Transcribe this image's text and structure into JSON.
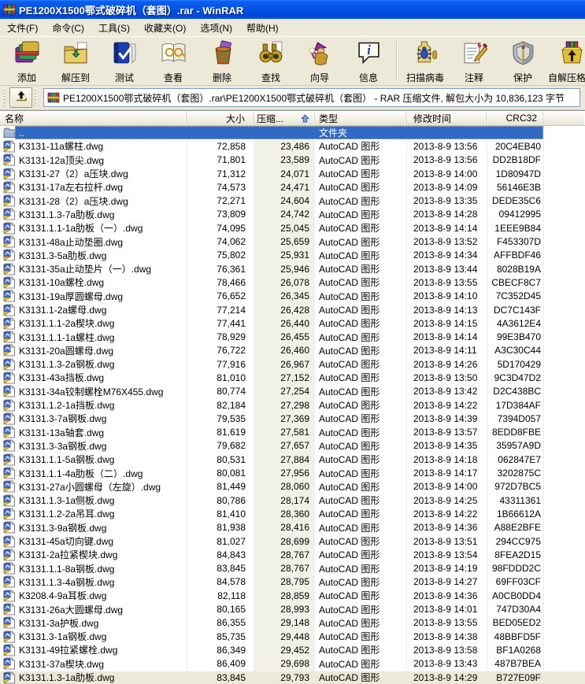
{
  "window": {
    "title": "PE1200X1500鄂式破碎机（套图）.rar - WinRAR"
  },
  "menu": {
    "items": [
      {
        "label": "文件(F)"
      },
      {
        "label": "命令(C)"
      },
      {
        "label": "工具(S)"
      },
      {
        "label": "收藏夹(O)"
      },
      {
        "label": "选项(N)"
      },
      {
        "label": "帮助(H)"
      }
    ]
  },
  "toolbar": {
    "buttons": [
      {
        "icon": "add-archive-icon",
        "label": "添加"
      },
      {
        "icon": "extract-to-icon",
        "label": "解压到"
      },
      {
        "icon": "test-archive-icon",
        "label": "测试"
      },
      {
        "icon": "view-file-icon",
        "label": "查看"
      },
      {
        "icon": "delete-icon",
        "label": "删除"
      },
      {
        "icon": "find-icon",
        "label": "查找"
      },
      {
        "icon": "wizard-icon",
        "label": "向导"
      },
      {
        "icon": "info-icon",
        "label": "信息"
      },
      {
        "icon": "virus-scan-icon",
        "label": "扫描病毒"
      },
      {
        "icon": "comment-icon",
        "label": "注释"
      },
      {
        "icon": "protect-icon",
        "label": "保护"
      },
      {
        "icon": "sfx-icon",
        "label": "自解压格式"
      }
    ]
  },
  "addressbar": {
    "path": "PE1200X1500鄂式破碎机（套图）.rar\\PE1200X1500鄂式破碎机（套图） - RAR 压缩文件, 解包大小为 10,836,123 字节"
  },
  "columns": {
    "name": "名称",
    "size": "大小",
    "packed": "压缩...",
    "type": "类型",
    "modified": "修改时间",
    "crc": "CRC32"
  },
  "folder_row": {
    "name": "..",
    "type": "文件夹"
  },
  "rows": [
    {
      "name": "K3131-11a螺柱.dwg",
      "size": "72,858",
      "packed": "23,486",
      "type": "AutoCAD 图形",
      "modified": "2013-8-9 13:56",
      "crc": "20C4EB40"
    },
    {
      "name": "K3131-12a顶尖.dwg",
      "size": "71,801",
      "packed": "23,589",
      "type": "AutoCAD 图形",
      "modified": "2013-8-9 13:56",
      "crc": "DD2B18DF"
    },
    {
      "name": "K3131-27（2）a压块.dwg",
      "size": "71,312",
      "packed": "24,071",
      "type": "AutoCAD 图形",
      "modified": "2013-8-9 14:00",
      "crc": "1D80947D"
    },
    {
      "name": "K3131-17a左右拉杆.dwg",
      "size": "74,573",
      "packed": "24,471",
      "type": "AutoCAD 图形",
      "modified": "2013-8-9 14:09",
      "crc": "56146E3B"
    },
    {
      "name": "K3131-28（2）a压块.dwg",
      "size": "72,271",
      "packed": "24,604",
      "type": "AutoCAD 图形",
      "modified": "2013-8-9 13:35",
      "crc": "DEDE35C6"
    },
    {
      "name": "K3131.1.3-7a肋板.dwg",
      "size": "73,809",
      "packed": "24,742",
      "type": "AutoCAD 图形",
      "modified": "2013-8-9 14:28",
      "crc": "09412995"
    },
    {
      "name": "K3131.1.1-1a肋板（一）.dwg",
      "size": "74,095",
      "packed": "25,045",
      "type": "AutoCAD 图形",
      "modified": "2013-8-9 14:14",
      "crc": "1EEE9B84"
    },
    {
      "name": "K3131-48a止动垫圈.dwg",
      "size": "74,062",
      "packed": "25,659",
      "type": "AutoCAD 图形",
      "modified": "2013-8-9 13:52",
      "crc": "F453307D"
    },
    {
      "name": "K3131.3-5a肋板.dwg",
      "size": "75,802",
      "packed": "25,931",
      "type": "AutoCAD 图形",
      "modified": "2013-8-9 14:34",
      "crc": "AFFBDF46"
    },
    {
      "name": "K3131-35a止动垫片（一）.dwg",
      "size": "76,361",
      "packed": "25,946",
      "type": "AutoCAD 图形",
      "modified": "2013-8-9 13:44",
      "crc": "8028B19A"
    },
    {
      "name": "K3131-10a螺栓.dwg",
      "size": "78,466",
      "packed": "26,078",
      "type": "AutoCAD 图形",
      "modified": "2013-8-9 13:55",
      "crc": "CBECF8C7"
    },
    {
      "name": "K3131-19a厚圆螺母.dwg",
      "size": "76,652",
      "packed": "26,345",
      "type": "AutoCAD 图形",
      "modified": "2013-8-9 14:10",
      "crc": "7C352D45"
    },
    {
      "name": "K3131.1-2a螺母.dwg",
      "size": "77,214",
      "packed": "26,428",
      "type": "AutoCAD 图形",
      "modified": "2013-8-9 14:13",
      "crc": "DC7C143F"
    },
    {
      "name": "K3131.1.1-2a楔块.dwg",
      "size": "77,441",
      "packed": "26,440",
      "type": "AutoCAD 图形",
      "modified": "2013-8-9 14:15",
      "crc": "4A3612E4"
    },
    {
      "name": "K3131.1.1-1a螺柱.dwg",
      "size": "78,929",
      "packed": "26,455",
      "type": "AutoCAD 图形",
      "modified": "2013-8-9 14:14",
      "crc": "99E3B470"
    },
    {
      "name": "K3131-20a圆螺母.dwg",
      "size": "76,722",
      "packed": "26,460",
      "type": "AutoCAD 图形",
      "modified": "2013-8-9 14:11",
      "crc": "A3C30C44"
    },
    {
      "name": "K3131.1.3-2a钢板.dwg",
      "size": "77,916",
      "packed": "26,967",
      "type": "AutoCAD 图形",
      "modified": "2013-8-9 14:26",
      "crc": "5D170429"
    },
    {
      "name": "K3131-43a挡板.dwg",
      "size": "81,010",
      "packed": "27,152",
      "type": "AutoCAD 图形",
      "modified": "2013-8-9 13:50",
      "crc": "9C3D47D2"
    },
    {
      "name": "K3131-34a铰制螺栓M76X455.dwg",
      "size": "80,774",
      "packed": "27,254",
      "type": "AutoCAD 图形",
      "modified": "2013-8-9 13:42",
      "crc": "D2C438BC"
    },
    {
      "name": "K3131.1.2-1a挡板.dwg",
      "size": "82,184",
      "packed": "27,298",
      "type": "AutoCAD 图形",
      "modified": "2013-8-9 14:22",
      "crc": "17D384AF"
    },
    {
      "name": "K3131.3-7a钢板.dwg",
      "size": "79,535",
      "packed": "27,369",
      "type": "AutoCAD 图形",
      "modified": "2013-8-9 14:39",
      "crc": "7394D057"
    },
    {
      "name": "K3131-13a轴套.dwg",
      "size": "81,619",
      "packed": "27,581",
      "type": "AutoCAD 图形",
      "modified": "2013-8-9 13:57",
      "crc": "8EDD8FBE"
    },
    {
      "name": "K3131.3-3a钢板.dwg",
      "size": "79,682",
      "packed": "27,657",
      "type": "AutoCAD 图形",
      "modified": "2013-8-9 14:35",
      "crc": "35957A9D"
    },
    {
      "name": "K3131.1.1-5a钢板.dwg",
      "size": "80,531",
      "packed": "27,884",
      "type": "AutoCAD 图形",
      "modified": "2013-8-9 14:18",
      "crc": "062847E7"
    },
    {
      "name": "K3131.1.1-4a肋板（二）.dwg",
      "size": "80,081",
      "packed": "27,956",
      "type": "AutoCAD 图形",
      "modified": "2013-8-9 14:17",
      "crc": "3202875C"
    },
    {
      "name": "K3131-27a小圆螺母（左旋）.dwg",
      "size": "81,449",
      "packed": "28,060",
      "type": "AutoCAD 图形",
      "modified": "2013-8-9 14:00",
      "crc": "972D7BC5"
    },
    {
      "name": "K3131.1.3-1a侧板.dwg",
      "size": "80,786",
      "packed": "28,174",
      "type": "AutoCAD 图形",
      "modified": "2013-8-9 14:25",
      "crc": "43311361"
    },
    {
      "name": "K3131.1.2-2a吊耳.dwg",
      "size": "81,410",
      "packed": "28,360",
      "type": "AutoCAD 图形",
      "modified": "2013-8-9 14:22",
      "crc": "1B66612A"
    },
    {
      "name": "K3131.3-9a钢板.dwg",
      "size": "81,938",
      "packed": "28,416",
      "type": "AutoCAD 图形",
      "modified": "2013-8-9 14:36",
      "crc": "A88E2BFE"
    },
    {
      "name": "K3131-45a切向键.dwg",
      "size": "81,027",
      "packed": "28,699",
      "type": "AutoCAD 图形",
      "modified": "2013-8-9 13:51",
      "crc": "294CC975"
    },
    {
      "name": "K3131-2a拉紧楔块.dwg",
      "size": "84,843",
      "packed": "28,767",
      "type": "AutoCAD 图形",
      "modified": "2013-8-9 13:54",
      "crc": "8FEA2D15"
    },
    {
      "name": "K3131.1.1-8a钢板.dwg",
      "size": "83,845",
      "packed": "28,767",
      "type": "AutoCAD 图形",
      "modified": "2013-8-9 14:19",
      "crc": "98FDDD2C"
    },
    {
      "name": "K3131.1.3-4a钢板.dwg",
      "size": "84,578",
      "packed": "28,795",
      "type": "AutoCAD 图形",
      "modified": "2013-8-9 14:27",
      "crc": "69FF03CF"
    },
    {
      "name": "K3208.4-9a耳板.dwg",
      "size": "82,118",
      "packed": "28,859",
      "type": "AutoCAD 图形",
      "modified": "2013-8-9 14:36",
      "crc": "A0CB0DD4"
    },
    {
      "name": "K3131-26a大圆螺母.dwg",
      "size": "80,165",
      "packed": "28,993",
      "type": "AutoCAD 图形",
      "modified": "2013-8-9 14:01",
      "crc": "747D30A4"
    },
    {
      "name": "K3131-3a护板.dwg",
      "size": "86,355",
      "packed": "29,148",
      "type": "AutoCAD 图形",
      "modified": "2013-8-9 13:55",
      "crc": "BED05ED2"
    },
    {
      "name": "K3131.3-1a钢板.dwg",
      "size": "85,735",
      "packed": "29,448",
      "type": "AutoCAD 图形",
      "modified": "2013-8-9 14:38",
      "crc": "48BBFD5F"
    },
    {
      "name": "K3131-49拉紧螺栓.dwg",
      "size": "86,349",
      "packed": "29,452",
      "type": "AutoCAD 图形",
      "modified": "2013-8-9 13:58",
      "crc": "BF1A0268"
    },
    {
      "name": "K3131-37a楔块.dwg",
      "size": "86,409",
      "packed": "29,698",
      "type": "AutoCAD 图形",
      "modified": "2013-8-9 13:43",
      "crc": "487B7BEA"
    }
  ],
  "partial_row": {
    "name": "K3131.1.3-1a肋板.dwg",
    "size": "83,845",
    "packed": "29,793",
    "type": "AutoCAD 图形",
    "modified": "2013-8-9 14:29",
    "crc": "B727E09F"
  },
  "colors": {
    "titlebar_blue": "#0655E8",
    "selection_blue": "#316AC5",
    "chrome_bg": "#ECE9D8",
    "list_bg": "#FFFFFF",
    "sorted_column_bg": "#F2F1E8"
  }
}
